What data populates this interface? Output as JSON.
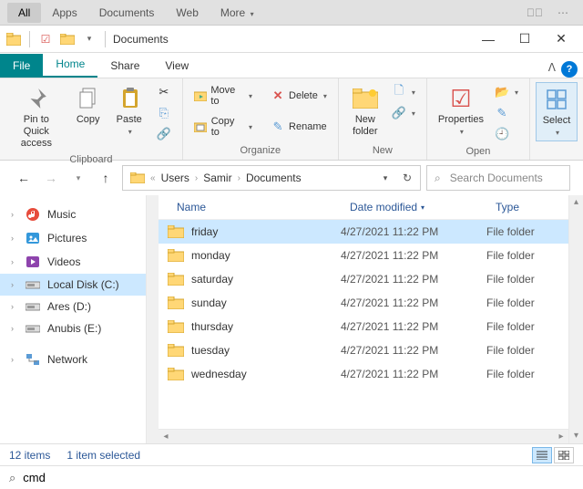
{
  "top_tabs": {
    "items": [
      "All",
      "Apps",
      "Documents",
      "Web",
      "More"
    ],
    "active": 0,
    "dd": "▾"
  },
  "window": {
    "title": "Documents"
  },
  "ribbon_tabs": {
    "file": "File",
    "items": [
      "Home",
      "Share",
      "View"
    ],
    "active": 0
  },
  "ribbon": {
    "clipboard": {
      "label": "Clipboard",
      "pin": "Pin to Quick\naccess",
      "copy": "Copy",
      "paste": "Paste"
    },
    "organize": {
      "label": "Organize",
      "moveto": "Move to",
      "copyto": "Copy to",
      "delete": "Delete",
      "rename": "Rename"
    },
    "new": {
      "label": "New",
      "newfolder": "New\nfolder"
    },
    "open": {
      "label": "Open",
      "properties": "Properties"
    },
    "select": {
      "label": "Select",
      "select": "Select"
    }
  },
  "breadcrumb": {
    "segs": [
      "Users",
      "Samir",
      "Documents"
    ]
  },
  "search": {
    "placeholder": "Search Documents"
  },
  "sidebar": {
    "items": [
      {
        "icon": "music",
        "label": "Music",
        "color": "#e74c3c"
      },
      {
        "icon": "pictures",
        "label": "Pictures",
        "color": "#3498db"
      },
      {
        "icon": "videos",
        "label": "Videos",
        "color": "#8e44ad"
      },
      {
        "icon": "disk",
        "label": "Local Disk (C:)",
        "color": "#555",
        "selected": true
      },
      {
        "icon": "disk",
        "label": "Ares (D:)",
        "color": "#555"
      },
      {
        "icon": "disk",
        "label": "Anubis (E:)",
        "color": "#555"
      }
    ],
    "network": "Network"
  },
  "columns": {
    "name": "Name",
    "date": "Date modified",
    "type": "Type"
  },
  "files": [
    {
      "name": "friday",
      "date": "4/27/2021 11:22 PM",
      "type": "File folder",
      "selected": true
    },
    {
      "name": "monday",
      "date": "4/27/2021 11:22 PM",
      "type": "File folder"
    },
    {
      "name": "saturday",
      "date": "4/27/2021 11:22 PM",
      "type": "File folder"
    },
    {
      "name": "sunday",
      "date": "4/27/2021 11:22 PM",
      "type": "File folder"
    },
    {
      "name": "thursday",
      "date": "4/27/2021 11:22 PM",
      "type": "File folder"
    },
    {
      "name": "tuesday",
      "date": "4/27/2021 11:22 PM",
      "type": "File folder"
    },
    {
      "name": "wednesday",
      "date": "4/27/2021 11:22 PM",
      "type": "File folder"
    }
  ],
  "status": {
    "count": "12 items",
    "selected": "1 item selected"
  },
  "cmd": {
    "value": "cmd"
  }
}
